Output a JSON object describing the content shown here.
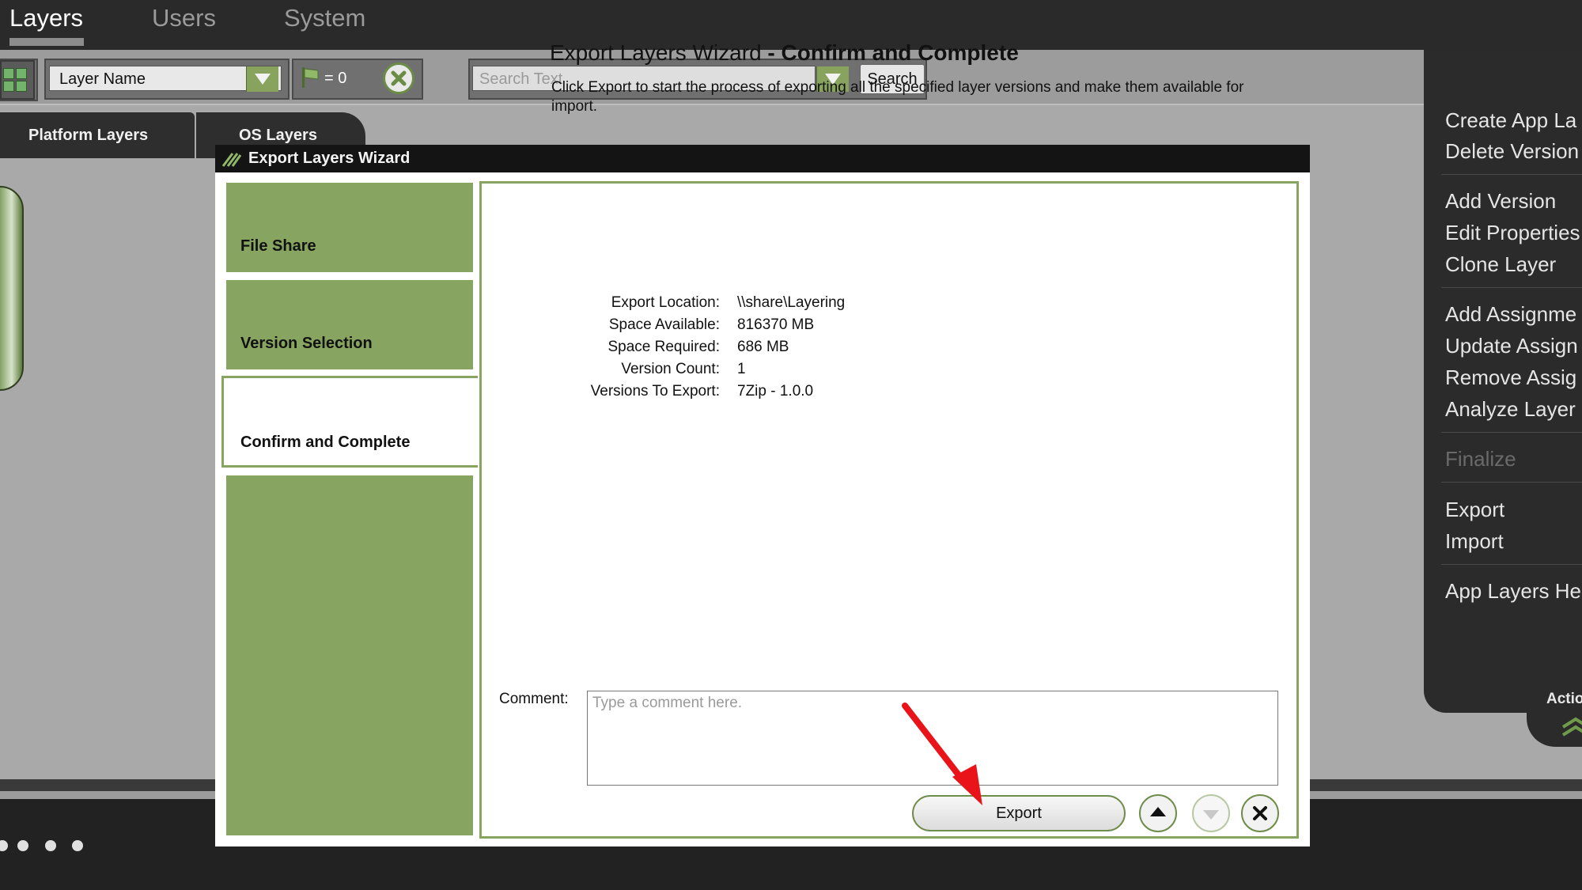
{
  "topnav": {
    "tabs": [
      "Layers",
      "Users",
      "System"
    ]
  },
  "toolbar": {
    "filter_value": "Layer Name",
    "flag_count": "= 0",
    "search_placeholder": "Search Text",
    "search_label": "Search"
  },
  "tabs": {
    "platform": "Platform Layers",
    "os": "OS Layers"
  },
  "sidebar": {
    "items": [
      {
        "label": "Create App La",
        "enabled": true
      },
      {
        "label": "Delete Version",
        "enabled": true
      },
      {
        "label": "Add Version",
        "enabled": true
      },
      {
        "label": "Edit Properties",
        "enabled": true
      },
      {
        "label": "Clone Layer",
        "enabled": true
      },
      {
        "label": "Add Assignme",
        "enabled": true
      },
      {
        "label": "Update Assign",
        "enabled": true
      },
      {
        "label": "Remove Assig",
        "enabled": true
      },
      {
        "label": "Analyze Layer",
        "enabled": true
      },
      {
        "label": "Finalize",
        "enabled": false
      },
      {
        "label": "Export",
        "enabled": true
      },
      {
        "label": "Import",
        "enabled": true
      },
      {
        "label": "App Layers He",
        "enabled": true
      }
    ],
    "actions_label": "Actio"
  },
  "wizard": {
    "window_title": "Export Layers Wizard",
    "steps": [
      "File Share",
      "Version Selection",
      "Confirm and Complete"
    ],
    "heading_prefix": "Export Layers Wizard",
    "heading_suffix": "- Confirm and Complete",
    "description": "Click Export to start the process of exporting all the specified layer versions and make them available for import.",
    "info": [
      {
        "label": "Export Location:",
        "value": "\\\\share\\Layering"
      },
      {
        "label": "Space Available:",
        "value": "816370 MB"
      },
      {
        "label": "Space Required:",
        "value": "686 MB"
      },
      {
        "label": "Version Count:",
        "value": "1"
      },
      {
        "label": "Versions To Export:",
        "value": "7Zip - 1.0.0"
      }
    ],
    "comment_label": "Comment:",
    "comment_placeholder": "Type a comment here.",
    "export_label": "Export"
  },
  "colors": {
    "accent_green": "#87a461",
    "annotation_red": "#e8141a"
  }
}
